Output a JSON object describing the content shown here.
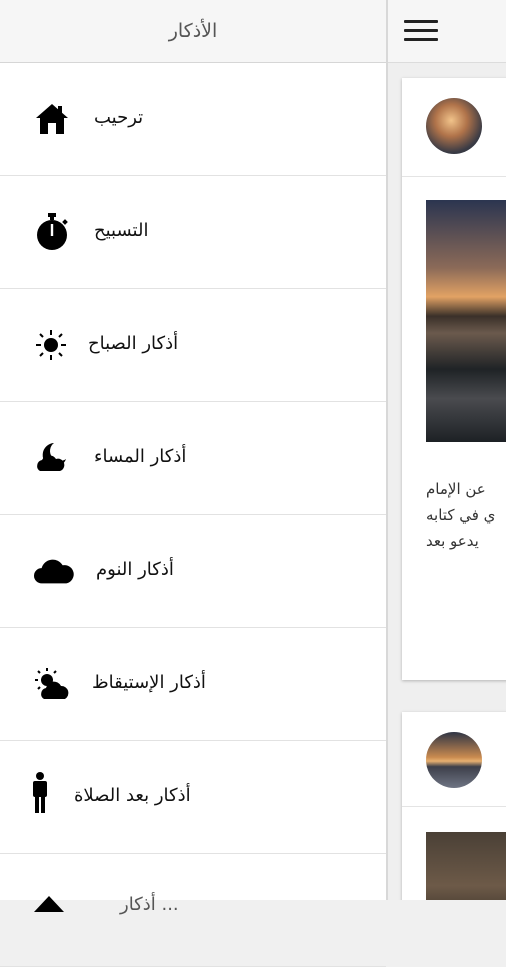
{
  "drawer": {
    "title": "الأذكار",
    "items": [
      {
        "label": "ترحيب",
        "icon": "home-icon"
      },
      {
        "label": "التسبيح",
        "icon": "stopwatch-icon"
      },
      {
        "label": "أذكار الصباح",
        "icon": "sun-icon"
      },
      {
        "label": "أذكار المساء",
        "icon": "moon-cloud-icon"
      },
      {
        "label": "أذكار النوم",
        "icon": "cloud-icon"
      },
      {
        "label": "أذكار الإستيقاظ",
        "icon": "sun-cloud-icon"
      },
      {
        "label": "أذكار بعد الصلاة",
        "icon": "person-icon"
      },
      {
        "label": "أذكار ...",
        "icon": "triangle-icon"
      }
    ]
  },
  "main": {
    "menu_icon": "hamburger-menu-icon",
    "cards": [
      {
        "text_lines": [
          "عن الإمام",
          "ي في كتابه",
          "يدعو بعد"
        ]
      },
      {
        "text_lines": []
      }
    ]
  }
}
